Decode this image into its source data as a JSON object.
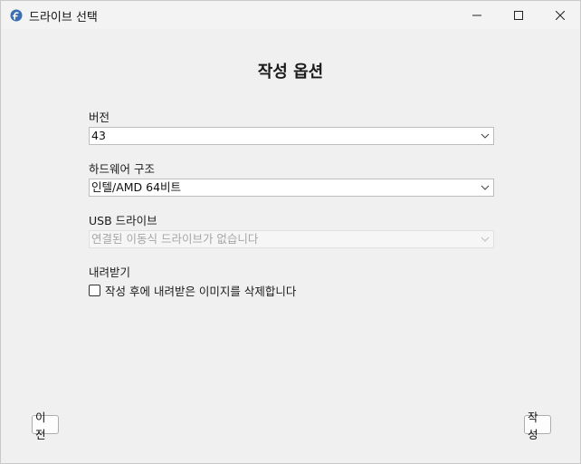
{
  "window": {
    "title": "드라이브 선택",
    "icon": "fedora-logo-icon",
    "controls": [
      "minimize-icon",
      "maximize-icon",
      "close-icon"
    ]
  },
  "page": {
    "heading": "작성 옵션"
  },
  "version": {
    "label": "버전",
    "selected": "43"
  },
  "architecture": {
    "label": "하드웨어 구조",
    "selected": "인텔/AMD 64비트"
  },
  "usb_drive": {
    "label": "USB 드라이브",
    "selected": "연결된 이동식 드라이브가 없습니다",
    "disabled": true
  },
  "download": {
    "label": "내려받기",
    "checkbox_label": "작성 후에 내려받은 이미지를 삭제합니다",
    "checked": false
  },
  "footer": {
    "prev_label": "이전",
    "write_label": "작성"
  },
  "colors": {
    "background": "#f0f0f0",
    "accent": "#3c6eb4"
  }
}
